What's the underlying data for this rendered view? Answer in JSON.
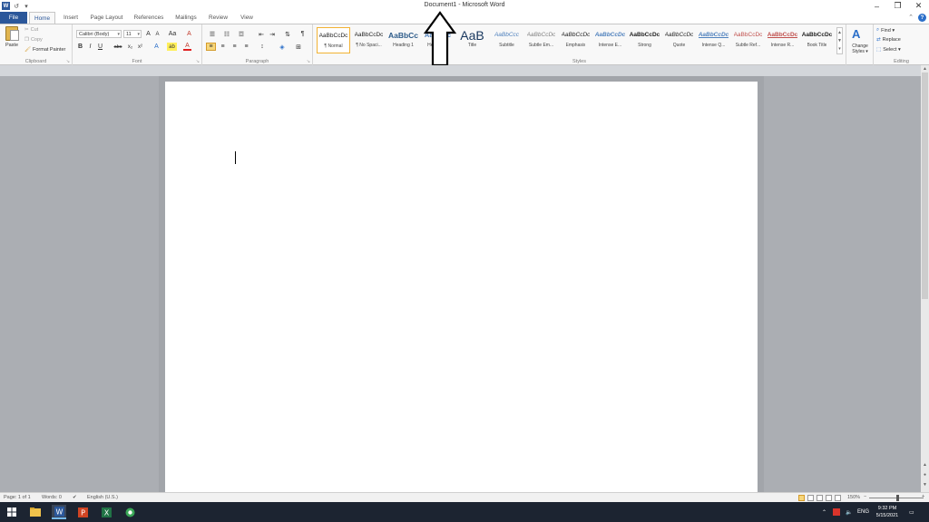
{
  "window": {
    "title": "Document1 - Microsoft Word",
    "minimize": "–",
    "restore": "❐",
    "close": "✕"
  },
  "qat": {
    "app_logo": "W",
    "undo": "↺",
    "redo": "▾"
  },
  "tabs": [
    "File",
    "Home",
    "Insert",
    "Page Layout",
    "References",
    "Mailings",
    "Review",
    "View"
  ],
  "tab_right": {
    "minimize_ribbon": "⌃",
    "help": "?"
  },
  "clipboard": {
    "label": "Clipboard",
    "paste": "Paste",
    "cut": "Cut",
    "copy": "Copy",
    "format_painter": "Format Painter"
  },
  "font": {
    "label": "Font",
    "name": "Calibri (Body)",
    "size": "11",
    "grow": "A",
    "shrink": "A",
    "change_case": "Aa",
    "clear": "A",
    "bold": "B",
    "italic": "I",
    "underline": "U",
    "strike": "abc",
    "subscript": "x₂",
    "superscript": "x²",
    "effects": "A",
    "highlight": "ab",
    "color": "A"
  },
  "paragraph": {
    "label": "Paragraph",
    "pilcrow": "¶"
  },
  "styles": {
    "label": "Styles",
    "items": [
      {
        "preview": "AaBbCcDc",
        "name": "¶ Normal"
      },
      {
        "preview": "AaBbCcDc",
        "name": "¶ No Spaci..."
      },
      {
        "preview": "AaBbCc",
        "name": "Heading 1"
      },
      {
        "preview": "AaBbCc",
        "name": "Heading 2"
      },
      {
        "preview": "AaB",
        "name": "Title"
      },
      {
        "preview": "AaBbCcc",
        "name": "Subtitle"
      },
      {
        "preview": "AaBbCcDc",
        "name": "Subtle Em..."
      },
      {
        "preview": "AaBbCcDc",
        "name": "Emphasis"
      },
      {
        "preview": "AaBbCcDc",
        "name": "Intense E..."
      },
      {
        "preview": "AaBbCcDc",
        "name": "Strong"
      },
      {
        "preview": "AaBbCcDc",
        "name": "Quote"
      },
      {
        "preview": "AaBbCcDc",
        "name": "Intense Q..."
      },
      {
        "preview": "AaBbCcDc",
        "name": "Subtle Ref..."
      },
      {
        "preview": "AaBbCcDc",
        "name": "Intense R..."
      },
      {
        "preview": "AaBbCcDc",
        "name": "Book Title"
      }
    ],
    "change_styles_1": "Change",
    "change_styles_2": "Styles ▾"
  },
  "editing": {
    "label": "Editing",
    "find": "Find ▾",
    "replace": "Replace",
    "select": "Select ▾"
  },
  "status": {
    "page": "Page: 1 of 1",
    "words": "Words: 0",
    "language": "English (U.S.)",
    "zoom": "150%",
    "zoom_minus": "−",
    "zoom_plus": "+"
  },
  "taskbar": {
    "tray_lang": "ENG",
    "time": "9:32 PM",
    "date": "5/15/2021"
  }
}
